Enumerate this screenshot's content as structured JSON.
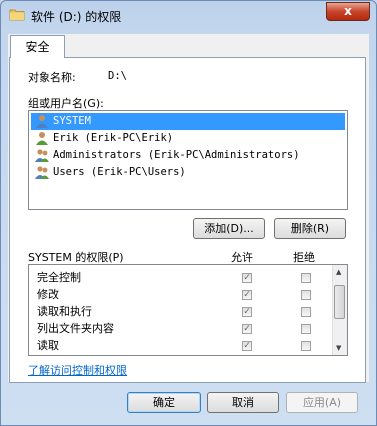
{
  "window": {
    "title": "软件 (D:) 的权限",
    "close_glyph": "x"
  },
  "tabs": [
    {
      "label": "安全"
    }
  ],
  "object": {
    "label": "对象名称:",
    "value": "D:\\"
  },
  "groups": {
    "label": "组或用户名(G):",
    "items": [
      {
        "name": "SYSTEM",
        "selected": true
      },
      {
        "name": "Erik (Erik-PC\\Erik)",
        "selected": false
      },
      {
        "name": "Administrators (Erik-PC\\Administrators)",
        "selected": false
      },
      {
        "name": "Users (Erik-PC\\Users)",
        "selected": false
      }
    ]
  },
  "buttons": {
    "add": "添加(D)...",
    "remove": "删除(R)",
    "ok": "确定",
    "cancel": "取消",
    "apply": "应用(A)"
  },
  "permissions": {
    "label": "SYSTEM 的权限(P)",
    "allow_header": "允许",
    "deny_header": "拒绝",
    "rows": [
      {
        "name": "完全控制",
        "allow": true,
        "deny": false
      },
      {
        "name": "修改",
        "allow": true,
        "deny": false
      },
      {
        "name": "读取和执行",
        "allow": true,
        "deny": false
      },
      {
        "name": "列出文件夹内容",
        "allow": true,
        "deny": false
      },
      {
        "name": "读取",
        "allow": true,
        "deny": false
      }
    ]
  },
  "link": "了解访问控制和权限",
  "colors": {
    "selection": "#3399ff",
    "link": "#0066cc",
    "close": "#c7452b"
  },
  "icons": [
    "folder-icon",
    "close-icon",
    "user-icon",
    "scroll-up-icon",
    "scroll-down-icon",
    "check-icon"
  ]
}
